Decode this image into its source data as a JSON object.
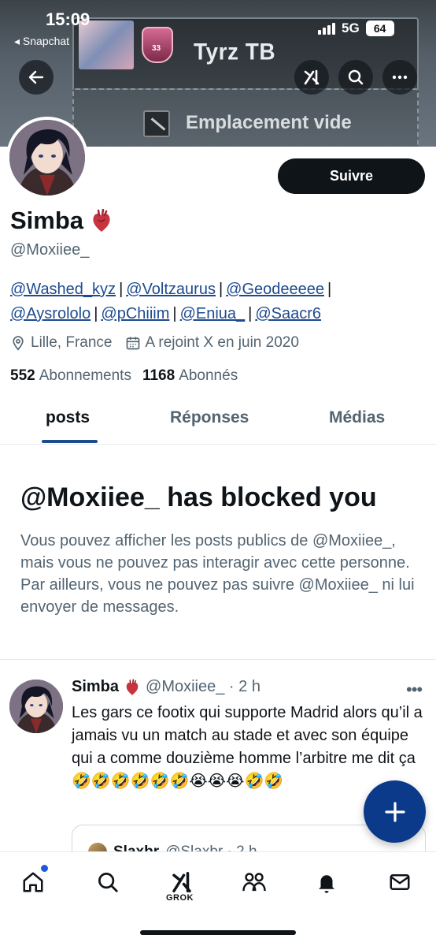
{
  "status_bar": {
    "time": "15:09",
    "back_app": "◂ Snapchat",
    "network": "5G",
    "battery": "64"
  },
  "banner": {
    "player_name": "Tyrz TB",
    "badge_number": "33",
    "slot_text": "Emplacement vide"
  },
  "profile": {
    "display_name": "Simba",
    "handle": "@Moxiiee_",
    "follow_label": "Suivre",
    "bio_mentions": [
      "@Washed_kyz",
      "@Voltzaurus",
      "@Geodeeeee",
      "@Aysrololo",
      "@pChiiim",
      "@Eniua_",
      "@Saacr6"
    ],
    "location": "Lille, France",
    "joined": "A rejoint X en juin 2020",
    "following_count": "552",
    "following_label": "Abonnements",
    "followers_count": "1168",
    "followers_label": "Abonnés"
  },
  "tabs": [
    {
      "label": "posts",
      "active": true
    },
    {
      "label": "Réponses",
      "active": false
    },
    {
      "label": "Médias",
      "active": false
    }
  ],
  "blocked": {
    "title": "@Moxiiee_ has blocked you",
    "body": "Vous pouvez afficher les posts publics de @Moxiiee_, mais vous ne pouvez pas interagir avec cette personne. Par ailleurs, vous ne pouvez pas suivre @Moxiiee_ ni lui envoyer de messages."
  },
  "post": {
    "author": "Simba",
    "handle_time": "@Moxiiee_ · 2 h",
    "text": "Les gars ce footix qui supporte Madrid alors qu’il a jamais vu un match au stade et avec son équipe qui a comme douzième homme l’arbitre me dit ça 🤣🤣🤣🤣🤣🤣😭😭😭🤣🤣",
    "quote_author": "Slaxbr",
    "quote_handle_time": "@Slaxbr · 2 h"
  },
  "bottom_nav": {
    "grok_label": "GROK",
    "items": [
      "home-icon",
      "search-icon",
      "grok-icon",
      "communities-icon",
      "notifications-icon",
      "messages-icon"
    ]
  },
  "colors": {
    "accent": "#1d4b8f",
    "fab": "#0b3a8a",
    "text_primary": "#0f1419",
    "text_secondary": "#536471"
  }
}
